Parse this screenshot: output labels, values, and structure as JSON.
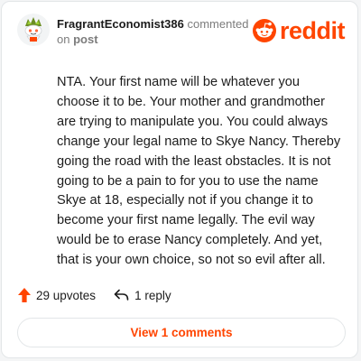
{
  "header": {
    "username": "FragrantEconomist386",
    "action": "commented",
    "on_text": "on",
    "link_text": "post",
    "logo_text": "reddit"
  },
  "comment": {
    "text": "NTA. Your first name will be whatever you choose it to be. Your mother and grandmother are trying to manipulate you. You could always change your legal name to Skye Nancy. Thereby going the road with the least obstacles. It is not going to be a pain to for you to use the name Skye at 18, especially not if you change it to become your first name legally. The evil way would be to erase Nancy completely. And yet, that is your own choice, so not so evil after all."
  },
  "actions": {
    "upvotes_label": "29 upvotes",
    "reply_label": "1 reply"
  },
  "footer": {
    "view_comments_label": "View 1 comments"
  },
  "colors": {
    "accent": "#ff4500",
    "text": "#1c1c1c",
    "muted": "#7c7c7c",
    "border": "#e3e6e8"
  }
}
